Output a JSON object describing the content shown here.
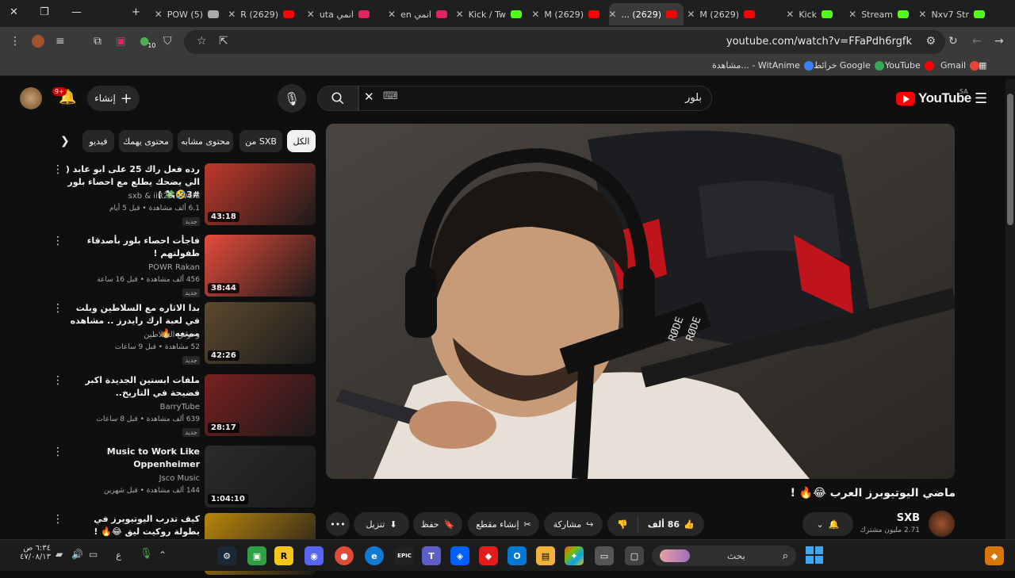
{
  "browser": {
    "tabs": [
      {
        "label": "POW (5)",
        "fav_color": "#aaaaaa"
      },
      {
        "label": "(2629) R",
        "fav_color": "#ff0000"
      },
      {
        "label": "انمي uta",
        "fav_color": "#e0245e"
      },
      {
        "label": "انمي en",
        "fav_color": "#e0245e"
      },
      {
        "label": "Kick / Tw",
        "fav_color": "#53fc18"
      },
      {
        "label": "(2629) M",
        "fav_color": "#ff0000"
      },
      {
        "label": "(2629) ...",
        "fav_color": "#ff0000",
        "active": true
      },
      {
        "label": "(2629) M",
        "fav_color": "#ff0000"
      },
      {
        "label": "Kick",
        "fav_color": "#53fc18"
      },
      {
        "label": "Stream",
        "fav_color": "#53fc18"
      },
      {
        "label": "Nxv7 Str",
        "fav_color": "#53fc18"
      }
    ],
    "url": "youtube.com/watch?v=FFaPdh6rgfk",
    "extension_badge": "10",
    "bookmarks": [
      {
        "label": "Gmail",
        "color": "#ea4335"
      },
      {
        "label": "YouTube",
        "color": "#ff0000"
      },
      {
        "label": "خرائط Google",
        "color": "#34a853"
      },
      {
        "label": "مشاهدة... - WitAnime",
        "color": "#3b82f6"
      }
    ]
  },
  "yt": {
    "logo_text": "YouTube",
    "region": "SA",
    "search_value": "بلور",
    "create_label": "إنشاء",
    "notif_count": "9+",
    "chips": [
      "الكل",
      "من SXB",
      "محتوى مشابه",
      "محتوى يهمك",
      "فيديو"
    ],
    "recommendations": [
      {
        "title": "رده فعل راك 25 على ابو عابد ( الي يضحك يطلع مع احصاء بلور #3🤣💸 )",
        "channel": "sxb & iiR25 lovers",
        "meta": "6.1 ألف مشاهدة • قبل 5 أيام",
        "duration": "43:18",
        "new": "جديد",
        "thumb": "#c0392b"
      },
      {
        "title": "فاجأت احصاء بلور بأصدقاء طفولتهم !",
        "channel": "POWR Rakan",
        "meta": "456 ألف مشاهدة • قبل 16 ساعة",
        "duration": "38:44",
        "new": "جديد",
        "thumb": "#e74c3c"
      },
      {
        "title": "بدا الاثاره مع السلاطين وبلت في لعبة ارك رايدرز .. مشاهده ممتعه 🔥",
        "channel": "وحوش السلاطين",
        "meta": "52 مشاهدة • قبل 9 ساعات",
        "duration": "42:26",
        "new": "جديد",
        "thumb": "#5d4a2e"
      },
      {
        "title": "ملفات ابستين الجديدة اكبر فضيحة في التاريخ..",
        "channel": "BarryTube",
        "meta": "639 ألف مشاهدة • قبل 8 ساعات",
        "duration": "28:17",
        "new": "جديد",
        "thumb": "#7a2020"
      },
      {
        "title": "Music to Work Like Oppenheimer",
        "channel": "Jsco Music",
        "meta": "144 ألف مشاهدة • قبل شهرين",
        "duration": "1:04:10",
        "new": "",
        "thumb": "#2b2b2b"
      },
      {
        "title": "كيف تدرب اليوتيوبرز في بطولة روكيت ليق 😂🔥 !",
        "channel": "",
        "meta": "",
        "duration": "",
        "new": "",
        "thumb": "#b8860b"
      }
    ],
    "video": {
      "title": "ماضي اليوتيوبرز العرب 😂🔥 !",
      "channel": "SXB",
      "subscribers": "2.71 مليون مشترك",
      "likes": "86 ألف",
      "share": "مشاركة",
      "clip": "إنشاء مقطع",
      "save": "حفظ",
      "download": "تنزيل",
      "mic_label": "RØDE"
    }
  },
  "taskbar": {
    "search_label": "بحث",
    "time": "٦:٣٤ ص",
    "date": "٤٧/٠٨/١٣",
    "lang": "ع"
  }
}
